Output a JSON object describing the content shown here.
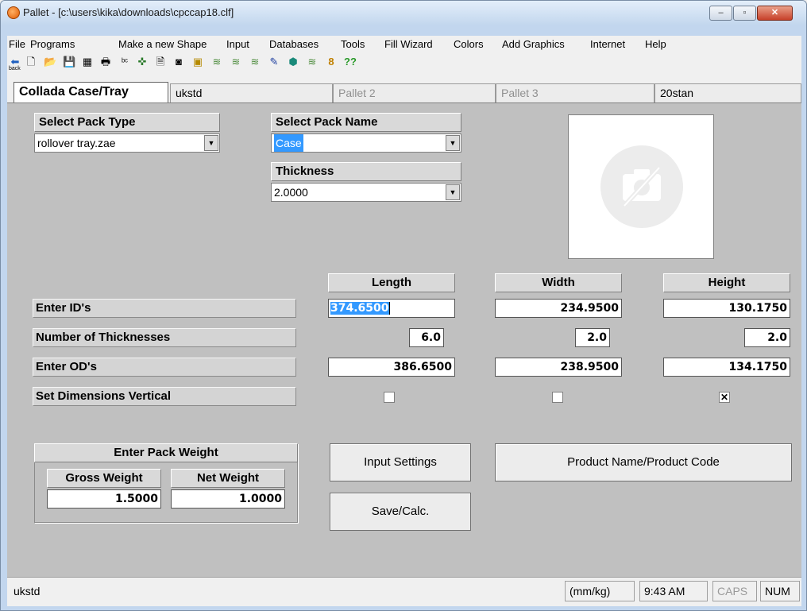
{
  "window": {
    "title": "Pallet - [c:\\users\\kika\\downloads\\cpccap18.clf]",
    "minimize_glyph": "–",
    "maximize_glyph": "▫",
    "close_glyph": "✕"
  },
  "menu": [
    "File",
    "Programs",
    "Make a new Shape",
    "Input",
    "Databases",
    "Tools",
    "Fill Wizard",
    "Colors",
    "Add Graphics",
    "Internet",
    "Help"
  ],
  "toolbar": {
    "back_label": "back",
    "icons": [
      {
        "name": "back-icon",
        "glyph": "⬅"
      },
      {
        "name": "new-document-icon",
        "glyph": "🗋"
      },
      {
        "name": "open-folder-icon",
        "glyph": "📂"
      },
      {
        "name": "save-icon",
        "glyph": "💾"
      },
      {
        "name": "calculator-icon",
        "glyph": "▦"
      },
      {
        "name": "print-icon",
        "glyph": "🖶"
      },
      {
        "name": "spell-check-icon",
        "glyph": "ᵇᶜ"
      },
      {
        "name": "puzzle-icon",
        "glyph": "✜"
      },
      {
        "name": "document-icon",
        "glyph": "🗎"
      },
      {
        "name": "print-preview-icon",
        "glyph": "◙"
      },
      {
        "name": "copy-shapes-icon",
        "glyph": "▣"
      },
      {
        "name": "layer-stack-icon",
        "glyph": "≋"
      },
      {
        "name": "layer-stack-2-icon",
        "glyph": "≋"
      },
      {
        "name": "layer-stack-3-icon",
        "glyph": "≋"
      },
      {
        "name": "paint-icon",
        "glyph": "✎"
      },
      {
        "name": "cube-icon",
        "glyph": "⬢"
      },
      {
        "name": "layer-stack-4-icon",
        "glyph": "≋"
      },
      {
        "name": "figure-icon",
        "glyph": "8"
      },
      {
        "name": "help-icon",
        "glyph": "??"
      }
    ]
  },
  "tabs": [
    {
      "label": "Collada Case/Tray",
      "state": "active"
    },
    {
      "label": "ukstd",
      "state": "normal"
    },
    {
      "label": "Pallet 2",
      "state": "disabled"
    },
    {
      "label": "Pallet 3",
      "state": "disabled"
    },
    {
      "label": "20stan",
      "state": "normal"
    }
  ],
  "pack_type": {
    "header": "Select Pack Type",
    "value": "rollover tray.zae"
  },
  "pack_name": {
    "header": "Select Pack Name",
    "value": "Case"
  },
  "thickness": {
    "header": "Thickness",
    "value": "2.0000"
  },
  "photo_placeholder_icon": "no-photo-icon",
  "dimensions": {
    "columns": [
      "Length",
      "Width",
      "Height"
    ],
    "rows": [
      {
        "label": "Enter ID's",
        "values": [
          "374.6500",
          "234.9500",
          "130.1750"
        ]
      },
      {
        "label": "Number of Thicknesses",
        "values": [
          "6.0",
          "2.0",
          "2.0"
        ]
      },
      {
        "label": "Enter OD's",
        "values": [
          "386.6500",
          "238.9500",
          "134.1750"
        ]
      },
      {
        "label": "Set Dimensions Vertical",
        "checks": [
          false,
          false,
          true
        ]
      }
    ]
  },
  "weight": {
    "header": "Enter Pack Weight",
    "gross_label": "Gross Weight",
    "gross_value": "1.5000",
    "net_label": "Net Weight",
    "net_value": "1.0000"
  },
  "buttons": {
    "input_settings": "Input Settings",
    "product_name": "Product Name/Product Code",
    "save_calc": "Save/Calc."
  },
  "status": {
    "left": "ukstd",
    "units": "(mm/kg)",
    "time": "9:43 AM",
    "caps": "CAPS",
    "num": "NUM"
  },
  "colors": {
    "panel": "#c0c0c0",
    "selection": "#3399ff",
    "title_gradient_top": "#e3eefa",
    "close_red": "#c7412a"
  }
}
